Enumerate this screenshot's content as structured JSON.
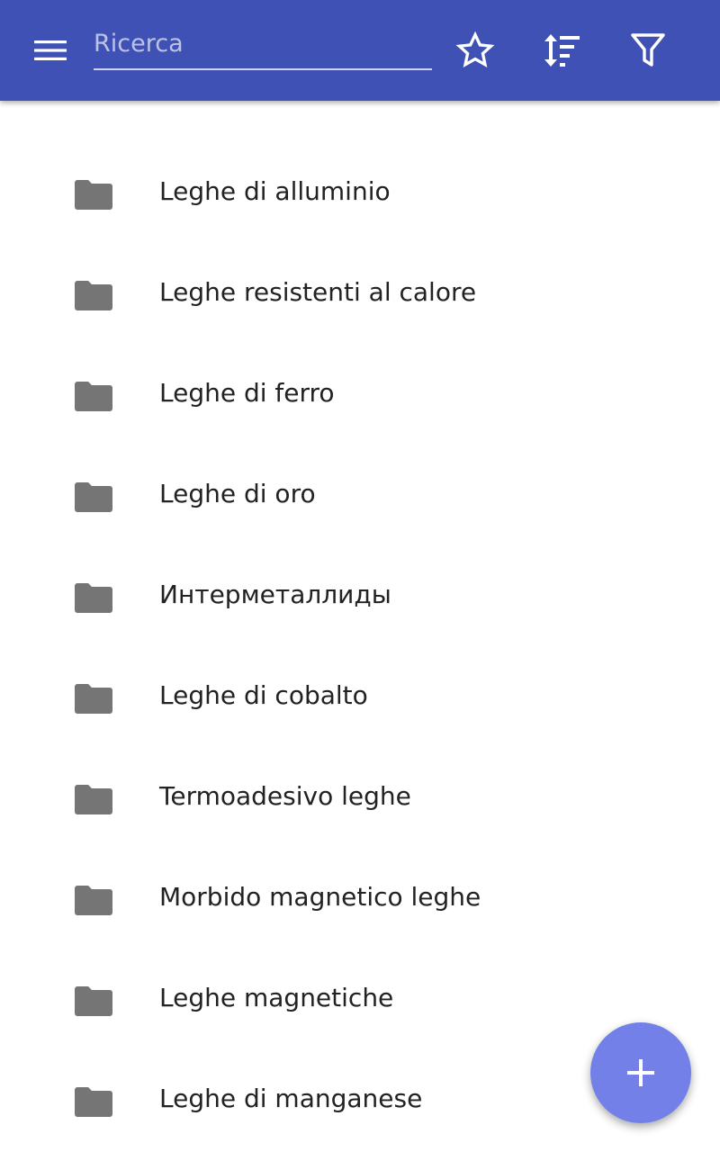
{
  "appbar": {
    "background": "#3f51b5",
    "menu_icon": "hamburger-menu-icon",
    "search": {
      "placeholder": "Ricerca",
      "value": ""
    },
    "actions": [
      "star-outline-icon",
      "sort-icon",
      "filter-icon"
    ]
  },
  "list": {
    "icon": "folder-icon",
    "items": [
      {
        "label": "Leghe di alluminio"
      },
      {
        "label": "Leghe resistenti al calore"
      },
      {
        "label": "Leghe di ferro"
      },
      {
        "label": "Leghe di oro"
      },
      {
        "label": "Интерметаллиды"
      },
      {
        "label": "Leghe di cobalto"
      },
      {
        "label": "Termoadesivo leghe"
      },
      {
        "label": "Morbido magnetico leghe"
      },
      {
        "label": "Leghe magnetiche"
      },
      {
        "label": "Leghe di manganese"
      }
    ]
  },
  "fab": {
    "icon": "plus-icon",
    "color": "#7280e8"
  }
}
